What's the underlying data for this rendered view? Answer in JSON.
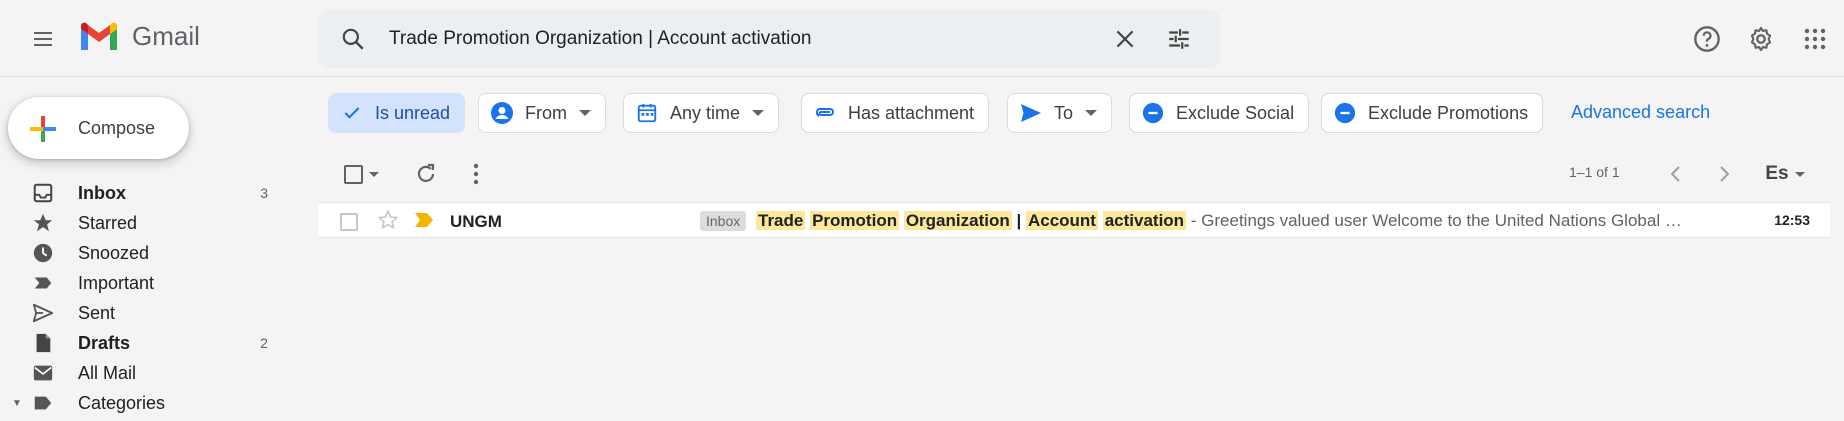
{
  "app": {
    "name": "Gmail"
  },
  "search": {
    "query": "Trade Promotion Organization | Account activation"
  },
  "compose": {
    "label": "Compose"
  },
  "nav": [
    {
      "label": "Inbox",
      "count": "3",
      "bold": true,
      "icon": "inbox-icon"
    },
    {
      "label": "Starred",
      "count": "",
      "bold": false,
      "icon": "star-icon"
    },
    {
      "label": "Snoozed",
      "count": "",
      "bold": false,
      "icon": "clock-icon"
    },
    {
      "label": "Important",
      "count": "",
      "bold": false,
      "icon": "label-important-icon"
    },
    {
      "label": "Sent",
      "count": "",
      "bold": false,
      "icon": "send-icon"
    },
    {
      "label": "Drafts",
      "count": "2",
      "bold": true,
      "icon": "draft-icon"
    },
    {
      "label": "All Mail",
      "count": "",
      "bold": false,
      "icon": "mail-icon"
    },
    {
      "label": "Categories",
      "count": "",
      "bold": false,
      "icon": "label-icon"
    }
  ],
  "chips": {
    "is_unread": "Is unread",
    "from": "From",
    "any_time": "Any time",
    "has_attachment": "Has attachment",
    "to": "To",
    "exclude_social": "Exclude Social",
    "exclude_promotions": "Exclude Promotions"
  },
  "advanced_search": "Advanced search",
  "pager": {
    "range": "1–1 of 1"
  },
  "input_tool": "Es",
  "email": {
    "sender": "UNGM",
    "label": "Inbox",
    "subject_parts": [
      "Trade",
      "Promotion",
      "Organization",
      "|",
      "Account",
      "activation"
    ],
    "snippet": " - Greetings valued user Welcome to the United Nations Global …",
    "time": "12:53"
  },
  "colors": {
    "accent": "#1a73e8",
    "highlight": "#fce79a",
    "chip_active": "#d3e3fd"
  }
}
